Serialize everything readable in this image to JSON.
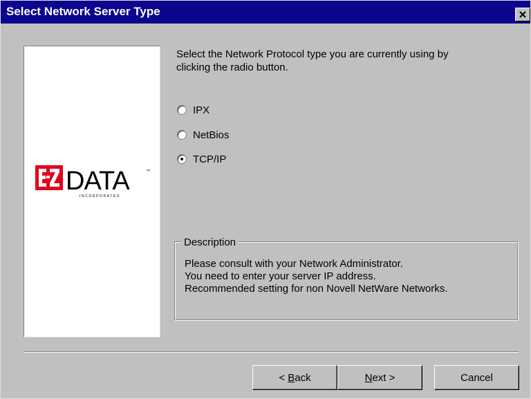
{
  "window": {
    "title": "Select Network Server Type",
    "close_label": "×"
  },
  "logo": {
    "brand": "E-Z DATA",
    "mark": "EZ",
    "word": "DATA",
    "tagline": "INCORPORATED"
  },
  "instructions": {
    "line1": "Select the Network Protocol type you are currently using by",
    "line2": "clicking the radio button."
  },
  "protocols": {
    "options": [
      {
        "label": "IPX",
        "checked": false
      },
      {
        "label": "NetBios",
        "checked": false
      },
      {
        "label": "TCP/IP",
        "checked": true
      }
    ]
  },
  "description": {
    "legend": "Description",
    "lines": [
      "Please consult with your Network Administrator.",
      "You need to enter your server IP address.",
      "Recommended setting for non Novell NetWare Networks."
    ]
  },
  "buttons": {
    "back_prefix": "< ",
    "back_underlined": "B",
    "back_rest": "ack",
    "next_underlined": "N",
    "next_rest": "ext >",
    "cancel": "Cancel"
  },
  "colors": {
    "titlebar": "#0c058d",
    "face": "#c0c0c0",
    "logo_red": "#e4001b"
  }
}
